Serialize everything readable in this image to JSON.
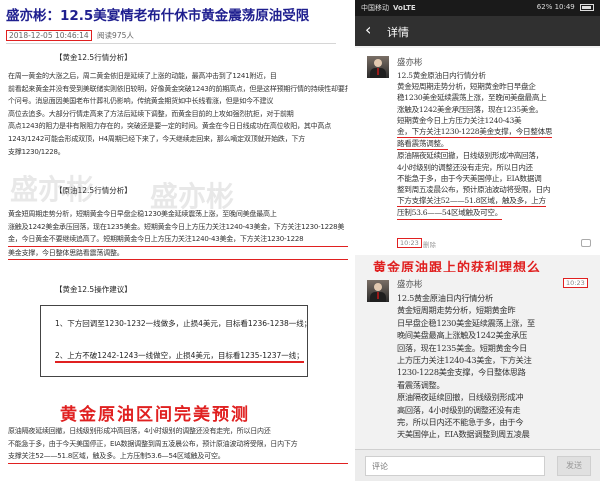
{
  "article": {
    "title": "盛亦彬：12.5美宴情老布什休市黄金震荡原油受限",
    "date": "2018-12-05 10:46:14",
    "views": "阅读975人",
    "section1": "【黄金12.5行情分析】",
    "para1": [
      "在周一黄金的大涨之后，周二黄金依旧是延续了上涨的动能，最高冲击到了1241附近，目",
      "前看起来黄金并没有受到美联储实则依旧较明，好像黄金突破1243的前期高点，但是这样预期行情的持续性却要打上一",
      "个问号。消息面因美国老布什葬礼仍影响，传统黄金期货如中长线看涨，但是如今不建议",
      "高位去追多。大部分行情走高来了方法后延续下调整，而黄金目前的上攻如强烈抗拒，对于前期",
      "高点1243的阻力是非有限阻力存在的，突破还是要一定的时间。黄金在今日日线成功在高位收阳，其中高点",
      "1243/1242可能会形成双顶，H4周期已经下来了，今天继续走回来，那么嘀定双顶就开始跌，下方",
      "支撑1230/1228。"
    ],
    "section2": "【原油12.5行情分析】",
    "para2": [
      "黄金短周期走势分析，短期黄金今日早盘企稳1230美金延续震荡上涨，至晚间美盘最高上",
      "涨触及1242美金承压回落，现在1235美金。短期黄金今日上方压力关注1240-43美金，下方关注1230-1228美",
      "金，今日黄金不要继续追高了。短期期黄金今日上方压力关注1240-43美金，下方关注1230-1228",
      "美金支撑，今日整体思路看震荡调整。"
    ],
    "section3": "【黄金12.5操作建议】",
    "op1": "1、下方回调至1230-1232一线做多，止损4美元，目标看1236-1238一线；",
    "op2": "2、上方不破1242-1243一线做空，止损4美元，目标看1235-1237一线；",
    "big_left": "黄金原油区间完美预测",
    "para3": [
      "原油隔夜延续回撤，日线级别形成冲高回落，4小时级别的调整还没有走完，所以日内还",
      "不能急于多，由于今天美国停正，EIA数据调整到周五凌晨公布，预计原油波动将受限，日内下方",
      "支撑关注52——51.8区域，触及多。上方压制53.6—54区域触及可空。"
    ],
    "watermarks": [
      "盛亦彬",
      "盛亦彬"
    ]
  },
  "phone": {
    "status_carrier": "中国移动",
    "status_network": "VoLTE",
    "status_right": "62%  10:49",
    "back_icon": "back-arrow-icon",
    "title": "详情",
    "msg1": {
      "author": "盛亦彬",
      "lines": [
        "12.5黄金原油日内行情分析",
        "黄金短周期走势分析，短期黄金昨日早盘企",
        "稳1230美金延续震荡上涨，至晚间美盘最高上",
        "涨触及1242美金承压回落，现在1235美金。",
        "短期黄金今日上方压力关注1240-43美",
        "金，下方关注1230-1228美金支撑，今日整体思",
        "路看震荡调整。",
        "原油隔夜延续回撤，日线级别形成冲高回落，",
        "4小时级别的调整还没有走完，所以日内还",
        "不能急于多，由于今天美国停止，EIA数据调",
        "整到周五凌晨公布，预计原油波动将受限，日内",
        "下方支撑关注52——51.8区域，触及多，上方",
        "压制53.6——54区域触及可空。"
      ],
      "time": "10:23",
      "delete": "删除"
    },
    "big_right": "黄金原油跟上的获利理想么",
    "msg2": {
      "author": "盛亦彬",
      "time": "10:23",
      "lines": [
        "12.5黄金原油日内行情分析",
        "黄金短周期走势分析，短期黄金昨",
        "日早盘企稳1230美金延续震荡上涨，至",
        "晚间美盘最高上涨触及1242美金承压",
        "回落，现在1235美金。短期黄金今日",
        "上方压力关注1240-43美金，下方关注",
        "1230-1228美金支撑，今日整体思路",
        "看震荡调整。",
        "原油隔夜延续回撤，日线级别形成冲",
        "高回落，4小时级别的调整还没有走",
        "完，所以日内还不能急于多，由于今",
        "天美国停止，EIA数据调整到周五凌晨"
      ]
    },
    "comment_placeholder": "评论",
    "send_label": "发送"
  }
}
